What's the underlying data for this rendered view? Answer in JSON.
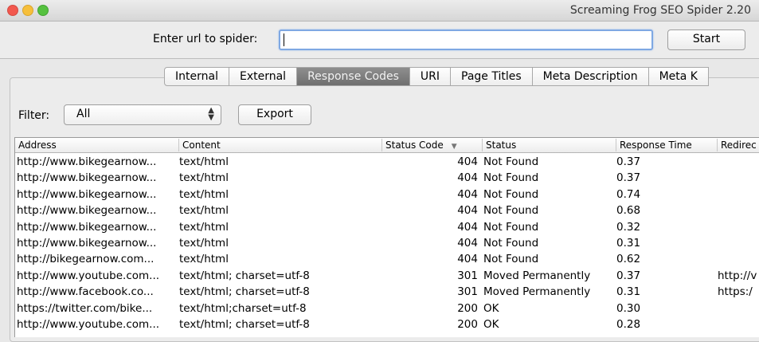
{
  "window": {
    "title": "Screaming Frog SEO Spider 2.20"
  },
  "url_bar": {
    "label": "Enter url to spider:",
    "value": "",
    "start_label": "Start"
  },
  "tabs": [
    "Internal",
    "External",
    "Response Codes",
    "URI",
    "Page Titles",
    "Meta Description",
    "Meta K"
  ],
  "active_tab": "Response Codes",
  "filter": {
    "label": "Filter:",
    "selected": "All",
    "export_label": "Export"
  },
  "table": {
    "columns": [
      "Address",
      "Content",
      "Status Code",
      "Status",
      "Response Time",
      "Redirec"
    ],
    "sorted_column": "Status Code",
    "rows": [
      {
        "address": "http://www.bikegearnow...",
        "content": "text/html",
        "code": "404",
        "status": "Not Found",
        "time": "0.37",
        "redirect": ""
      },
      {
        "address": "http://www.bikegearnow...",
        "content": "text/html",
        "code": "404",
        "status": "Not Found",
        "time": "0.37",
        "redirect": ""
      },
      {
        "address": "http://www.bikegearnow...",
        "content": "text/html",
        "code": "404",
        "status": "Not Found",
        "time": "0.74",
        "redirect": ""
      },
      {
        "address": "http://www.bikegearnow...",
        "content": "text/html",
        "code": "404",
        "status": "Not Found",
        "time": "0.68",
        "redirect": ""
      },
      {
        "address": "http://www.bikegearnow...",
        "content": "text/html",
        "code": "404",
        "status": "Not Found",
        "time": "0.32",
        "redirect": ""
      },
      {
        "address": "http://www.bikegearnow...",
        "content": "text/html",
        "code": "404",
        "status": "Not Found",
        "time": "0.31",
        "redirect": ""
      },
      {
        "address": "http://bikegearnow.com...",
        "content": "text/html",
        "code": "404",
        "status": "Not Found",
        "time": "0.62",
        "redirect": ""
      },
      {
        "address": "http://www.youtube.com...",
        "content": "text/html; charset=utf-8",
        "code": "301",
        "status": "Moved Permanently",
        "time": "0.37",
        "redirect": "http://v"
      },
      {
        "address": "http://www.facebook.co...",
        "content": "text/html; charset=utf-8",
        "code": "301",
        "status": "Moved Permanently",
        "time": "0.31",
        "redirect": "https:/"
      },
      {
        "address": "https://twitter.com/bike...",
        "content": "text/html;charset=utf-8",
        "code": "200",
        "status": "OK",
        "time": "0.30",
        "redirect": ""
      },
      {
        "address": "http://www.youtube.com...",
        "content": "text/html; charset=utf-8",
        "code": "200",
        "status": "OK",
        "time": "0.28",
        "redirect": ""
      }
    ]
  }
}
